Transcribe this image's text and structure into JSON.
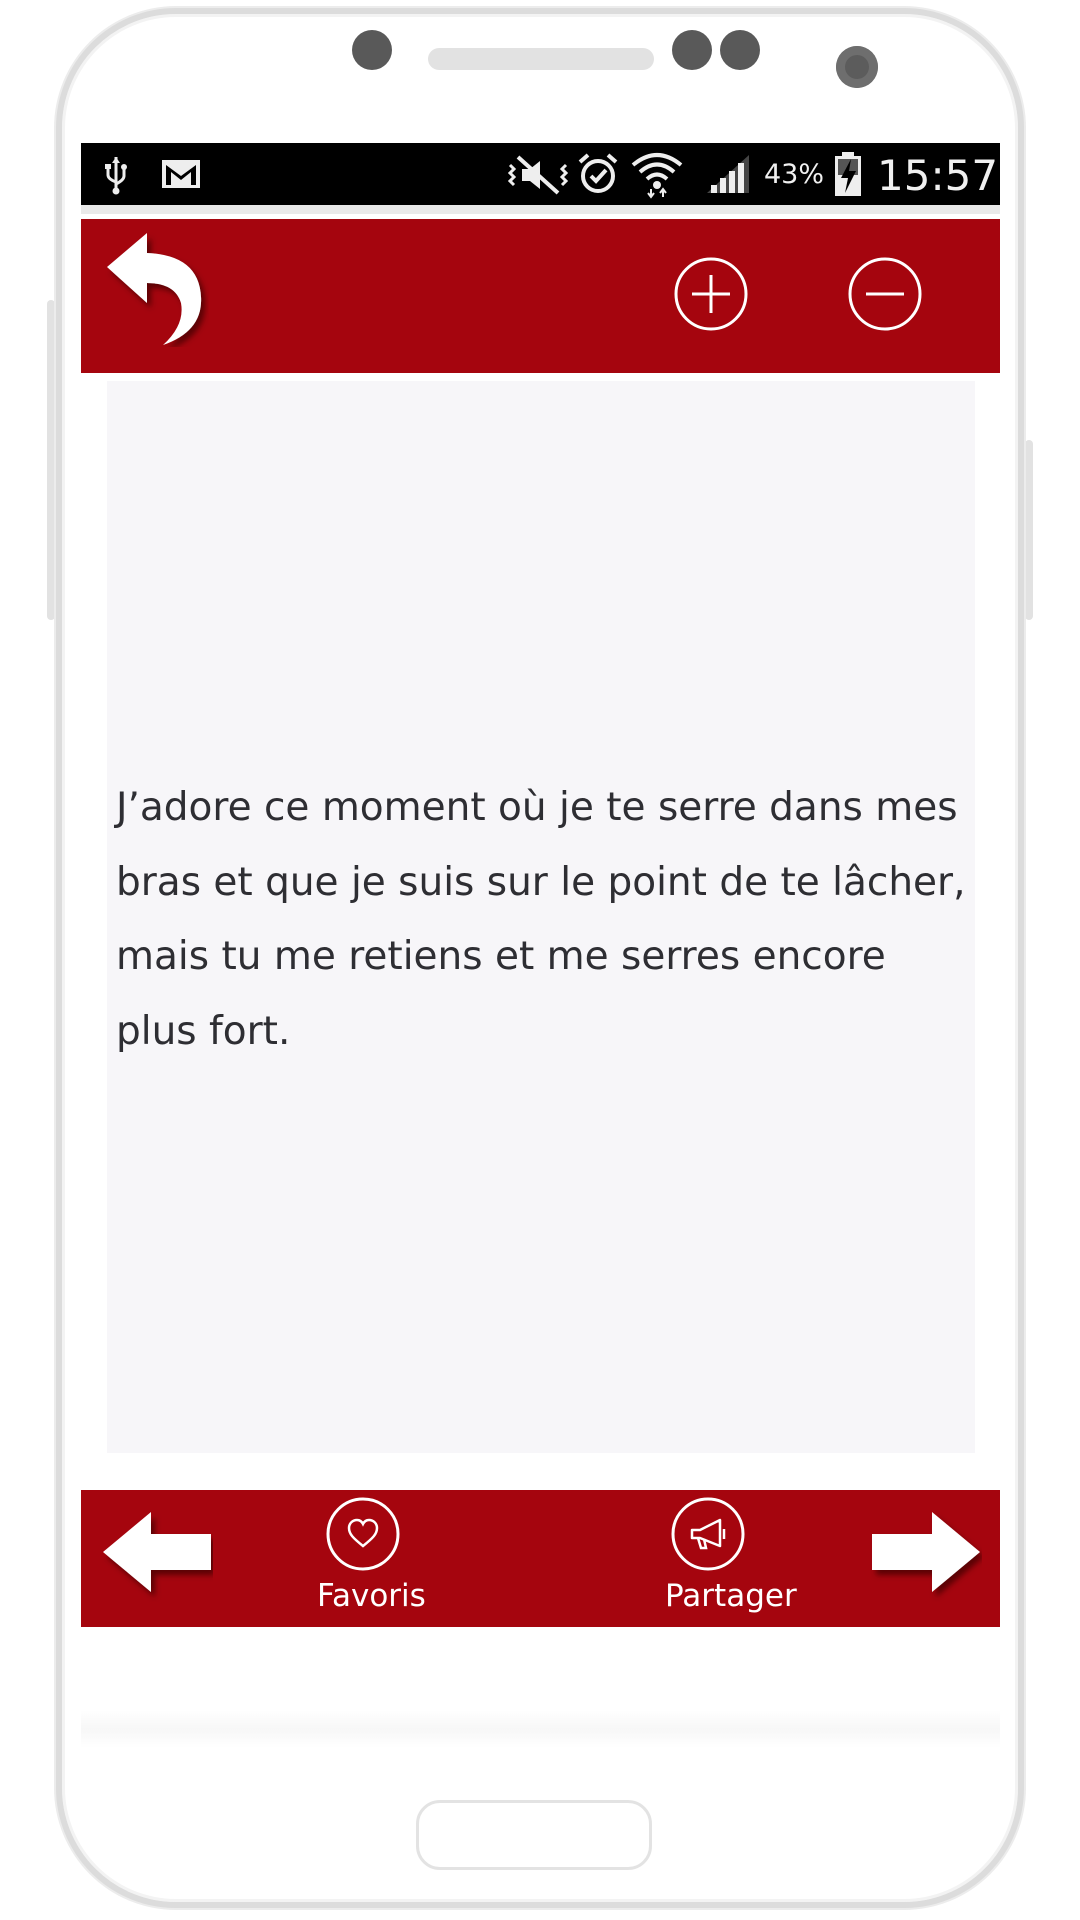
{
  "status_bar": {
    "icons": [
      "usb-icon",
      "gmail-icon",
      "mute-vibrate-icon",
      "alarm-icon",
      "wifi-icon",
      "signal-icon",
      "battery-charging-icon"
    ],
    "battery_percent": "43%",
    "time": "15:57"
  },
  "toolbar": {
    "icons": [
      "back-arrow-icon",
      "zoom-in-icon",
      "zoom-out-icon"
    ]
  },
  "message": {
    "text": "J’adore ce moment où je te serre dans mes bras et que je suis sur le point de te lâcher, mais tu me retiens et me serres encore plus fort."
  },
  "bottom_bar": {
    "favorites_label": "Favoris",
    "share_label": "Partager",
    "icons": [
      "previous-arrow-icon",
      "heart-icon",
      "megaphone-icon",
      "next-arrow-icon"
    ]
  },
  "colors": {
    "accent_red": "#a5050e",
    "content_background": "#f7f6f9",
    "text": "#2e2e33"
  }
}
